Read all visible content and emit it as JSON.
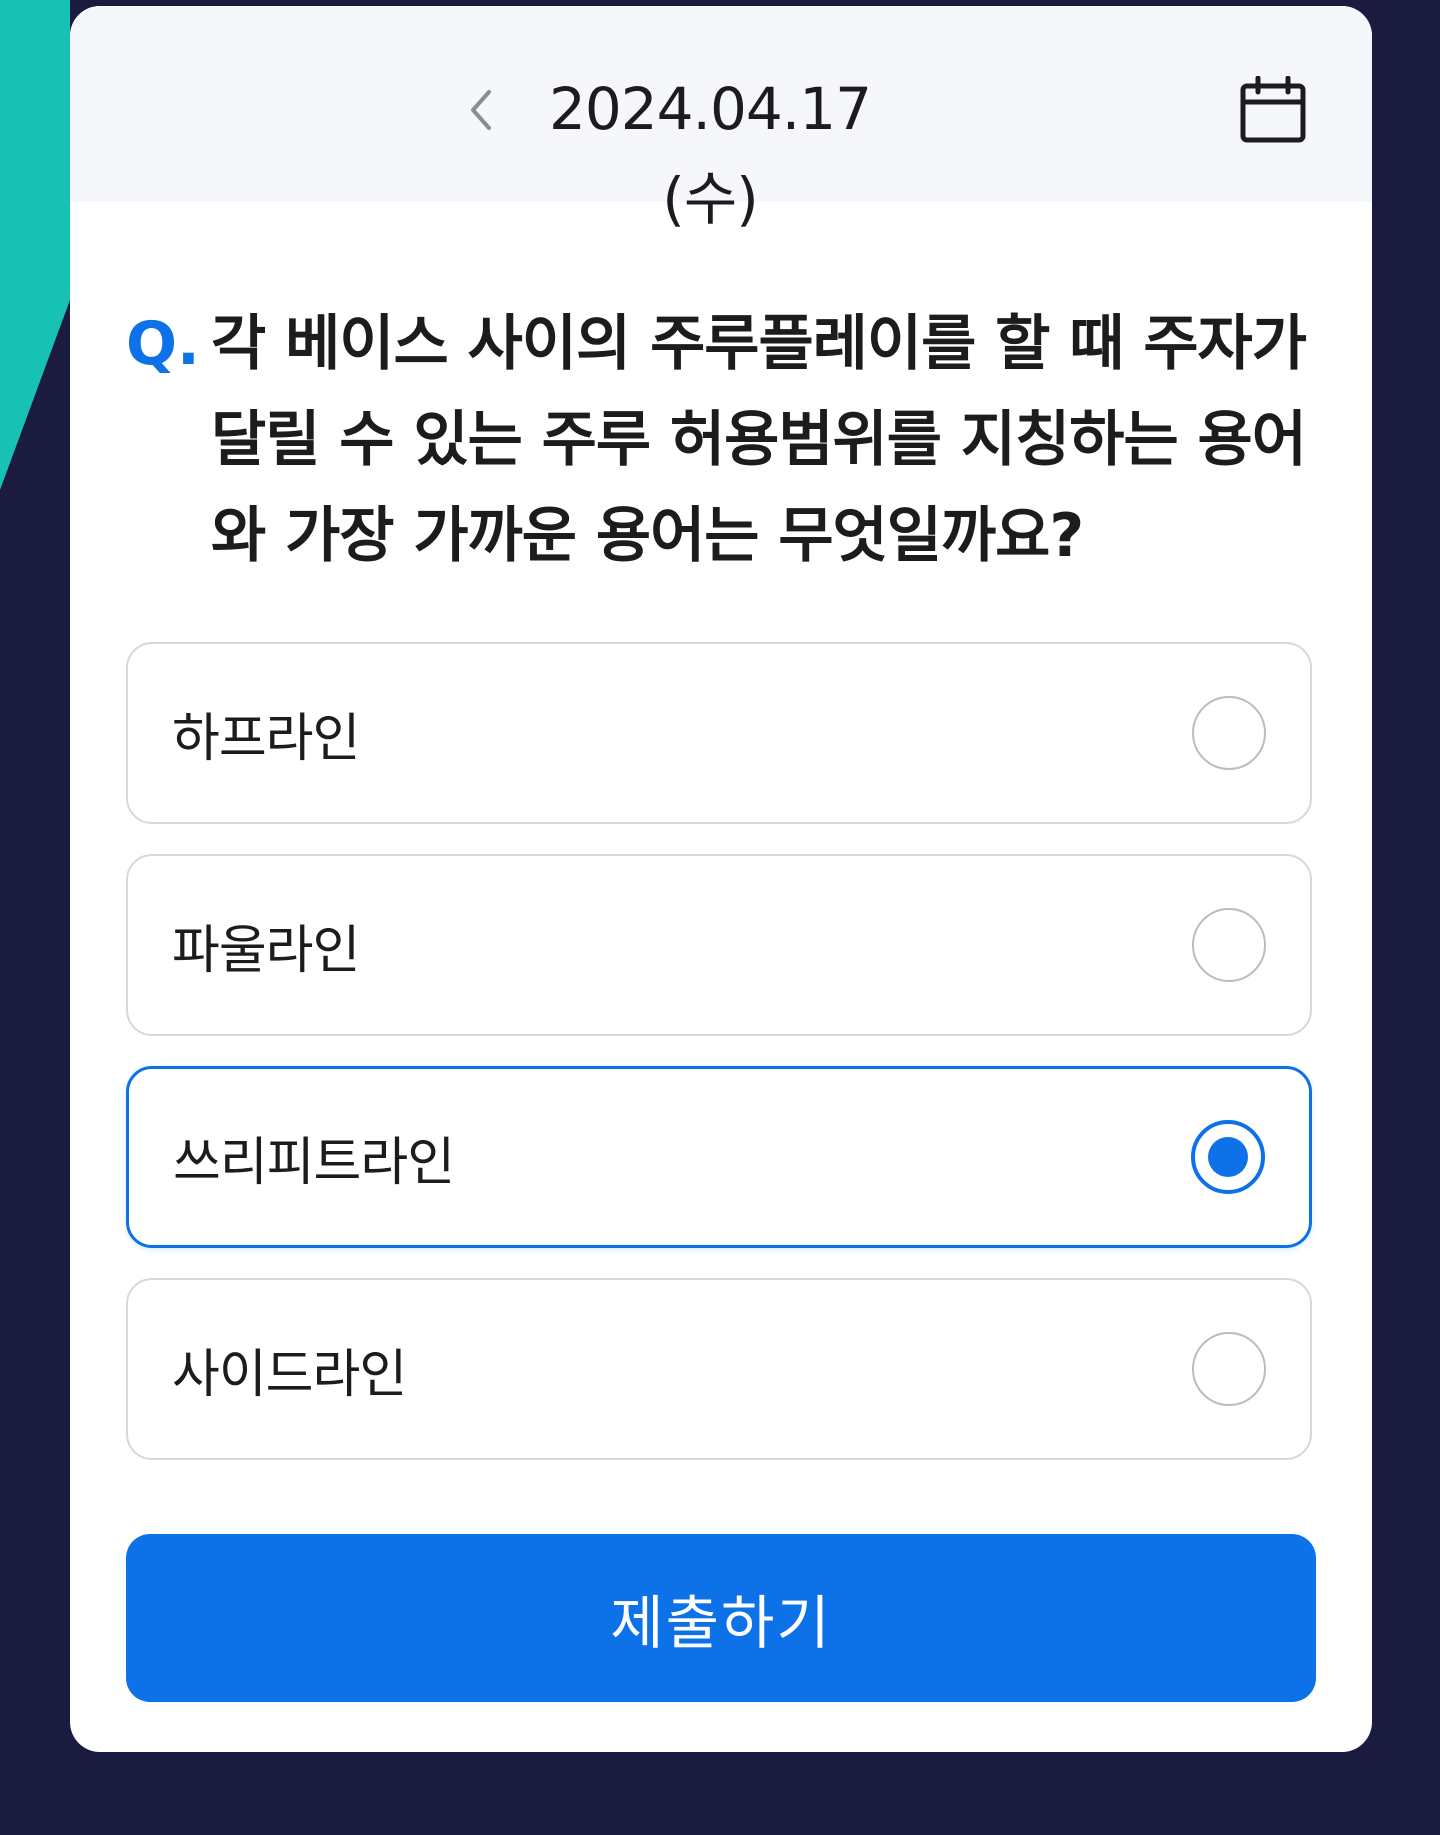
{
  "header": {
    "date": "2024.04.17 (수)",
    "prev_icon": "chevron-left-icon",
    "calendar_icon": "calendar-icon"
  },
  "question": {
    "prefix": "Q.",
    "text": "각 베이스 사이의 주루플레이를 할 때 주자가 달릴 수 있는 주루 허용범위를 지칭하는 용어와 가장 가까운 용어는 무엇일까요?"
  },
  "options": [
    {
      "label": "하프라인",
      "selected": false
    },
    {
      "label": "파울라인",
      "selected": false
    },
    {
      "label": "쓰리피트라인",
      "selected": true
    },
    {
      "label": "사이드라인",
      "selected": false
    }
  ],
  "submit": {
    "label": "제출하기"
  },
  "colors": {
    "accent": "#0d72e8",
    "background": "#1a1b3f",
    "stripe": "#17c2b5",
    "header_bg": "#f6f7fb"
  }
}
